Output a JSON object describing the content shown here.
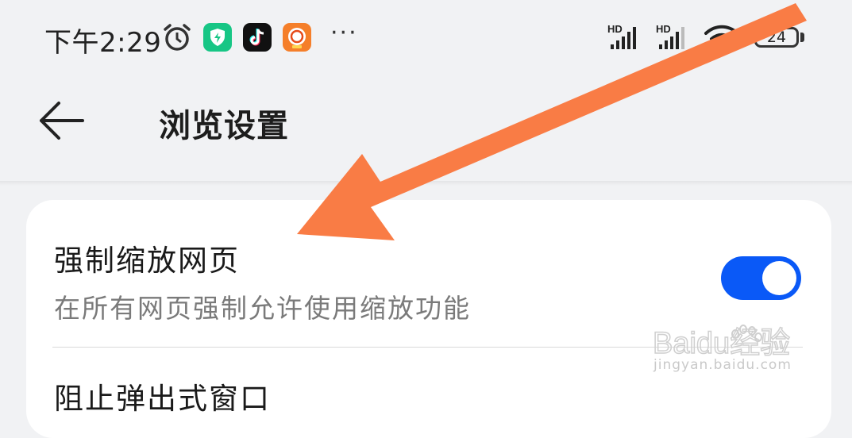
{
  "status_bar": {
    "time": "下午2:29",
    "battery": "24",
    "signal_labels": [
      "HD",
      "HD"
    ],
    "more": "···"
  },
  "header": {
    "title": "浏览设置",
    "back_icon": "arrow-left-icon"
  },
  "settings": [
    {
      "title": "强制缩放网页",
      "description": "在所有网页强制允许使用缩放功能",
      "toggle_on": true
    },
    {
      "title": "阻止弹出式窗口"
    }
  ],
  "colors": {
    "toggle_on": "#0a59f7",
    "arrow": "#f97c45",
    "background": "#f1f2f4"
  },
  "watermark": {
    "brand": "Baidu经验",
    "url": "jingyan.baidu.com"
  }
}
